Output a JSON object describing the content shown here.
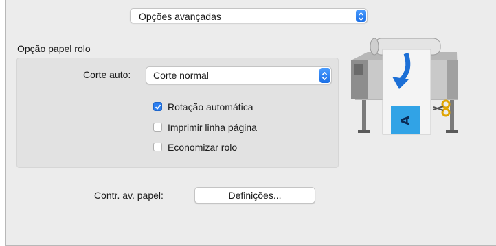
{
  "advanced_options_select": {
    "value": "Opções avançadas"
  },
  "roll_paper": {
    "group_title": "Opção papel rolo",
    "auto_cut_label": "Corte auto:",
    "auto_cut_value": "Corte normal",
    "checkboxes": [
      {
        "label": "Rotação automática",
        "checked": true
      },
      {
        "label": "Imprimir linha página",
        "checked": false
      },
      {
        "label": "Economizar rolo",
        "checked": false
      }
    ]
  },
  "paper_feed": {
    "label": "Contr. av. papel:",
    "button_label": "Definições..."
  },
  "illustration": {
    "page_letter": "A"
  },
  "colors": {
    "accent": "#2b7ef0",
    "panel_bg": "#ececec",
    "group_bg": "#e2e2e2"
  }
}
